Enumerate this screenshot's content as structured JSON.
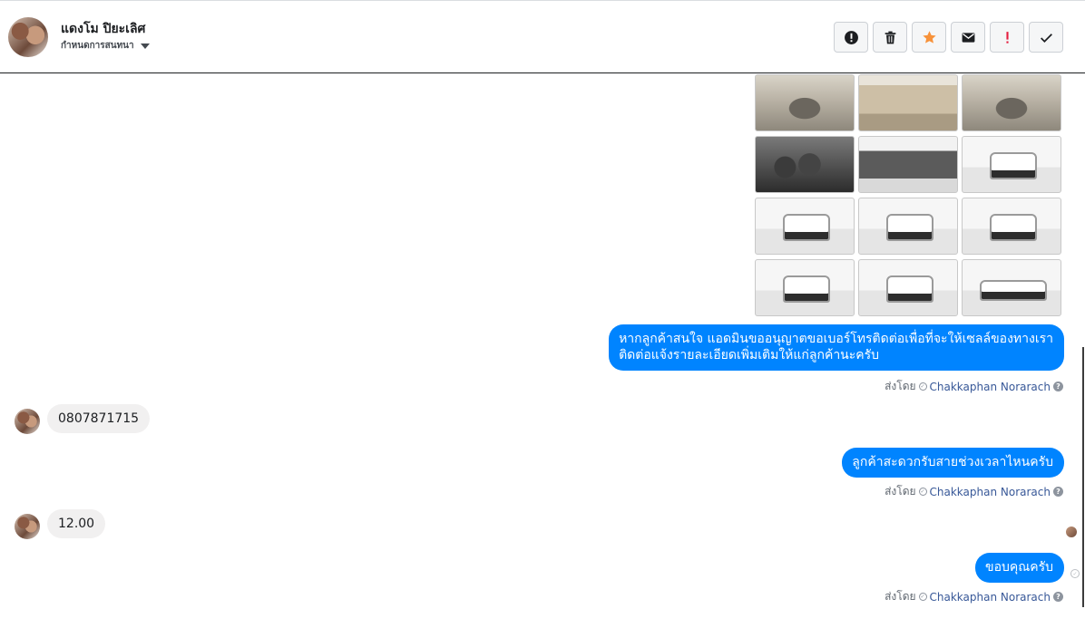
{
  "header": {
    "contact_name": "แดงโม ปิยะเลิศ",
    "conversation_settings": "กำหนดการสนทนา",
    "tools": [
      {
        "name": "report-icon"
      },
      {
        "name": "trash-icon"
      },
      {
        "name": "star-icon",
        "color": "#f7923a"
      },
      {
        "name": "mail-icon"
      },
      {
        "name": "exclamation-icon",
        "color": "#e41e3f"
      },
      {
        "name": "checkmark-icon"
      }
    ]
  },
  "photos": [
    {
      "kind": "interior"
    },
    {
      "kind": "seats"
    },
    {
      "kind": "interior"
    },
    {
      "kind": "dash"
    },
    {
      "kind": "engine"
    },
    {
      "kind": "car"
    },
    {
      "kind": "car"
    },
    {
      "kind": "car"
    },
    {
      "kind": "car"
    },
    {
      "kind": "car"
    },
    {
      "kind": "car"
    },
    {
      "kind": "side"
    }
  ],
  "messages": [
    {
      "direction": "out",
      "lines": [
        "หากลูกค้าสนใจ แอดมินขออนุญาตขอเบอร์โทรติดต่อเพื่อที่จะให้เซลล์ของทางเรา",
        "ติดต่อแจ้งรายละเอียดเพิ่มเติมให้แก่ลูกค้านะครับ"
      ]
    },
    {
      "direction": "in",
      "text": "0807871715"
    },
    {
      "direction": "out",
      "text": "ลูกค้าสะดวกรับสายช่วงเวลาไหนครับ"
    },
    {
      "direction": "in",
      "text": "12.00"
    },
    {
      "direction": "out",
      "text": "ขอบคุณครับ"
    }
  ],
  "sent_by": {
    "prefix": "ส่งโดย",
    "agent": "Chakkaphan Norarach"
  },
  "colors": {
    "outgoing_bubble": "#0084ff",
    "incoming_bubble": "#f1f0f0",
    "agent_link": "#385898"
  }
}
